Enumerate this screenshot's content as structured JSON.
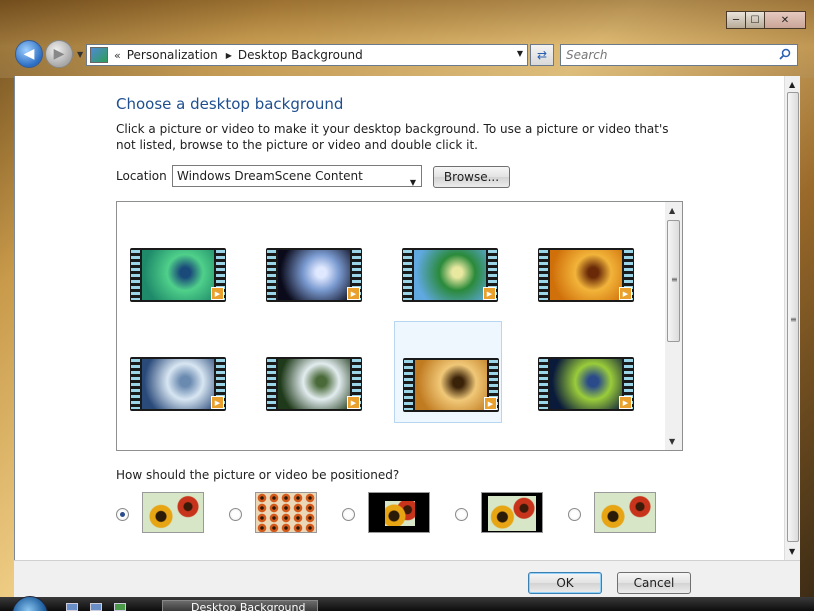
{
  "window": {
    "controls": {
      "minimize": "─",
      "maximize": "☐",
      "close": "✕"
    }
  },
  "nav": {
    "back_icon": "arrow-left-icon",
    "forward_icon": "arrow-right-icon",
    "recent_icon": "chevron-down-icon"
  },
  "address": {
    "overflow": "«",
    "crumbs": [
      "Personalization",
      "Desktop Background"
    ],
    "separator": "▶",
    "dropdown": "▼"
  },
  "refresh_icon": "⇄",
  "search": {
    "placeholder": "Search"
  },
  "page": {
    "title": "Choose a desktop background",
    "description": "Click a picture or video to make it your desktop background. To use a picture or video that's not listed, browse to the picture or video and double click it.",
    "location_label": "Location",
    "location_value": "Windows DreamScene Content",
    "browse_label": "Browse...",
    "position_question": "How should the picture or video be positioned?"
  },
  "gallery": {
    "items": [
      {
        "name": "aurora",
        "colors": [
          "#1f8a6a",
          "#4fd08a",
          "#1a4a7a"
        ]
      },
      {
        "name": "light-rays",
        "colors": [
          "#0a0a1a",
          "#7a9ad0",
          "#dfe8ff"
        ]
      },
      {
        "name": "leaf",
        "colors": [
          "#5fa8e0",
          "#2a8a3a",
          "#e8e8a0"
        ]
      },
      {
        "name": "autumn-leaves",
        "colors": [
          "#d0700a",
          "#f2b43a",
          "#6a2a08"
        ]
      },
      {
        "name": "ice-mountain",
        "colors": [
          "#2a4a7a",
          "#d8e6f2",
          "#6a8ab0"
        ]
      },
      {
        "name": "waterfall",
        "colors": [
          "#1f3a1a",
          "#e2ecef",
          "#4a6a3a"
        ]
      },
      {
        "name": "flowers",
        "colors": [
          "#c07a20",
          "#f0c878",
          "#3a2208"
        ]
      },
      {
        "name": "night-lanterns",
        "colors": [
          "#0a1a3a",
          "#9acc3a",
          "#2a4a8a"
        ]
      }
    ],
    "selected_index": 6,
    "play_icon": "▶"
  },
  "positions": [
    {
      "name": "fill",
      "selected": true
    },
    {
      "name": "tile",
      "selected": false
    },
    {
      "name": "center",
      "selected": false
    },
    {
      "name": "stretch",
      "selected": false
    },
    {
      "name": "fit",
      "selected": false
    }
  ],
  "footer": {
    "ok_label": "OK",
    "cancel_label": "Cancel"
  },
  "taskbar": {
    "active_window": "Desktop Background"
  },
  "colors": {
    "accent": "#1f4f8f",
    "selection": "#eef7fd"
  }
}
